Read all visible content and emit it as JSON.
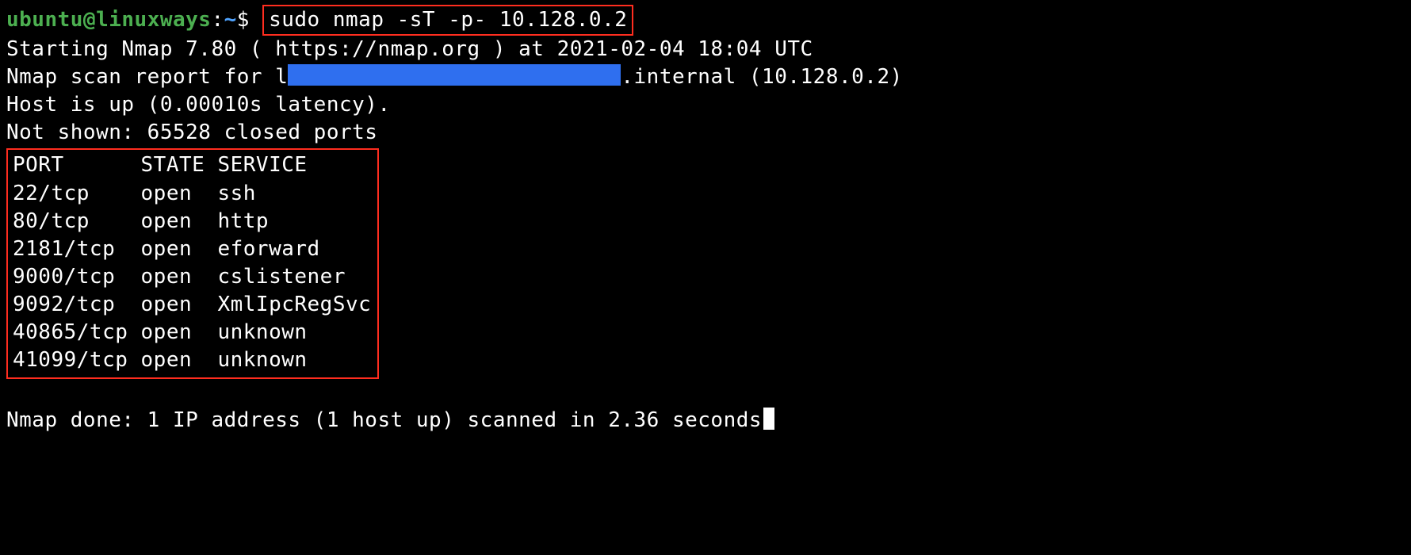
{
  "prompt": {
    "user": "ubuntu",
    "at": "@",
    "host": "linuxways",
    "sep": ":",
    "path": "~",
    "dollar": "$"
  },
  "command": "sudo nmap -sT -p- 10.128.0.2",
  "lines": {
    "starting": "Starting Nmap 7.80 ( https://nmap.org ) at 2021-02-04 18:04 UTC",
    "scan_report_pre": "Nmap scan report for l",
    "scan_report_post": ".internal (10.128.0.2)",
    "host_up": "Host is up (0.00010s latency).",
    "not_shown": "Not shown: 65528 closed ports",
    "done": "Nmap done: 1 IP address (1 host up) scanned in 2.36 seconds"
  },
  "table": {
    "headers": {
      "port": "PORT",
      "state": "STATE",
      "service": "SERVICE"
    },
    "rows": [
      {
        "port": "22/tcp",
        "state": "open",
        "service": "ssh"
      },
      {
        "port": "80/tcp",
        "state": "open",
        "service": "http"
      },
      {
        "port": "2181/tcp",
        "state": "open",
        "service": "eforward"
      },
      {
        "port": "9000/tcp",
        "state": "open",
        "service": "cslistener"
      },
      {
        "port": "9092/tcp",
        "state": "open",
        "service": "XmlIpcRegSvc"
      },
      {
        "port": "40865/tcp",
        "state": "open",
        "service": "unknown"
      },
      {
        "port": "41099/tcp",
        "state": "open",
        "service": "unknown"
      }
    ]
  },
  "col_widths": {
    "port": 10,
    "state": 6
  }
}
